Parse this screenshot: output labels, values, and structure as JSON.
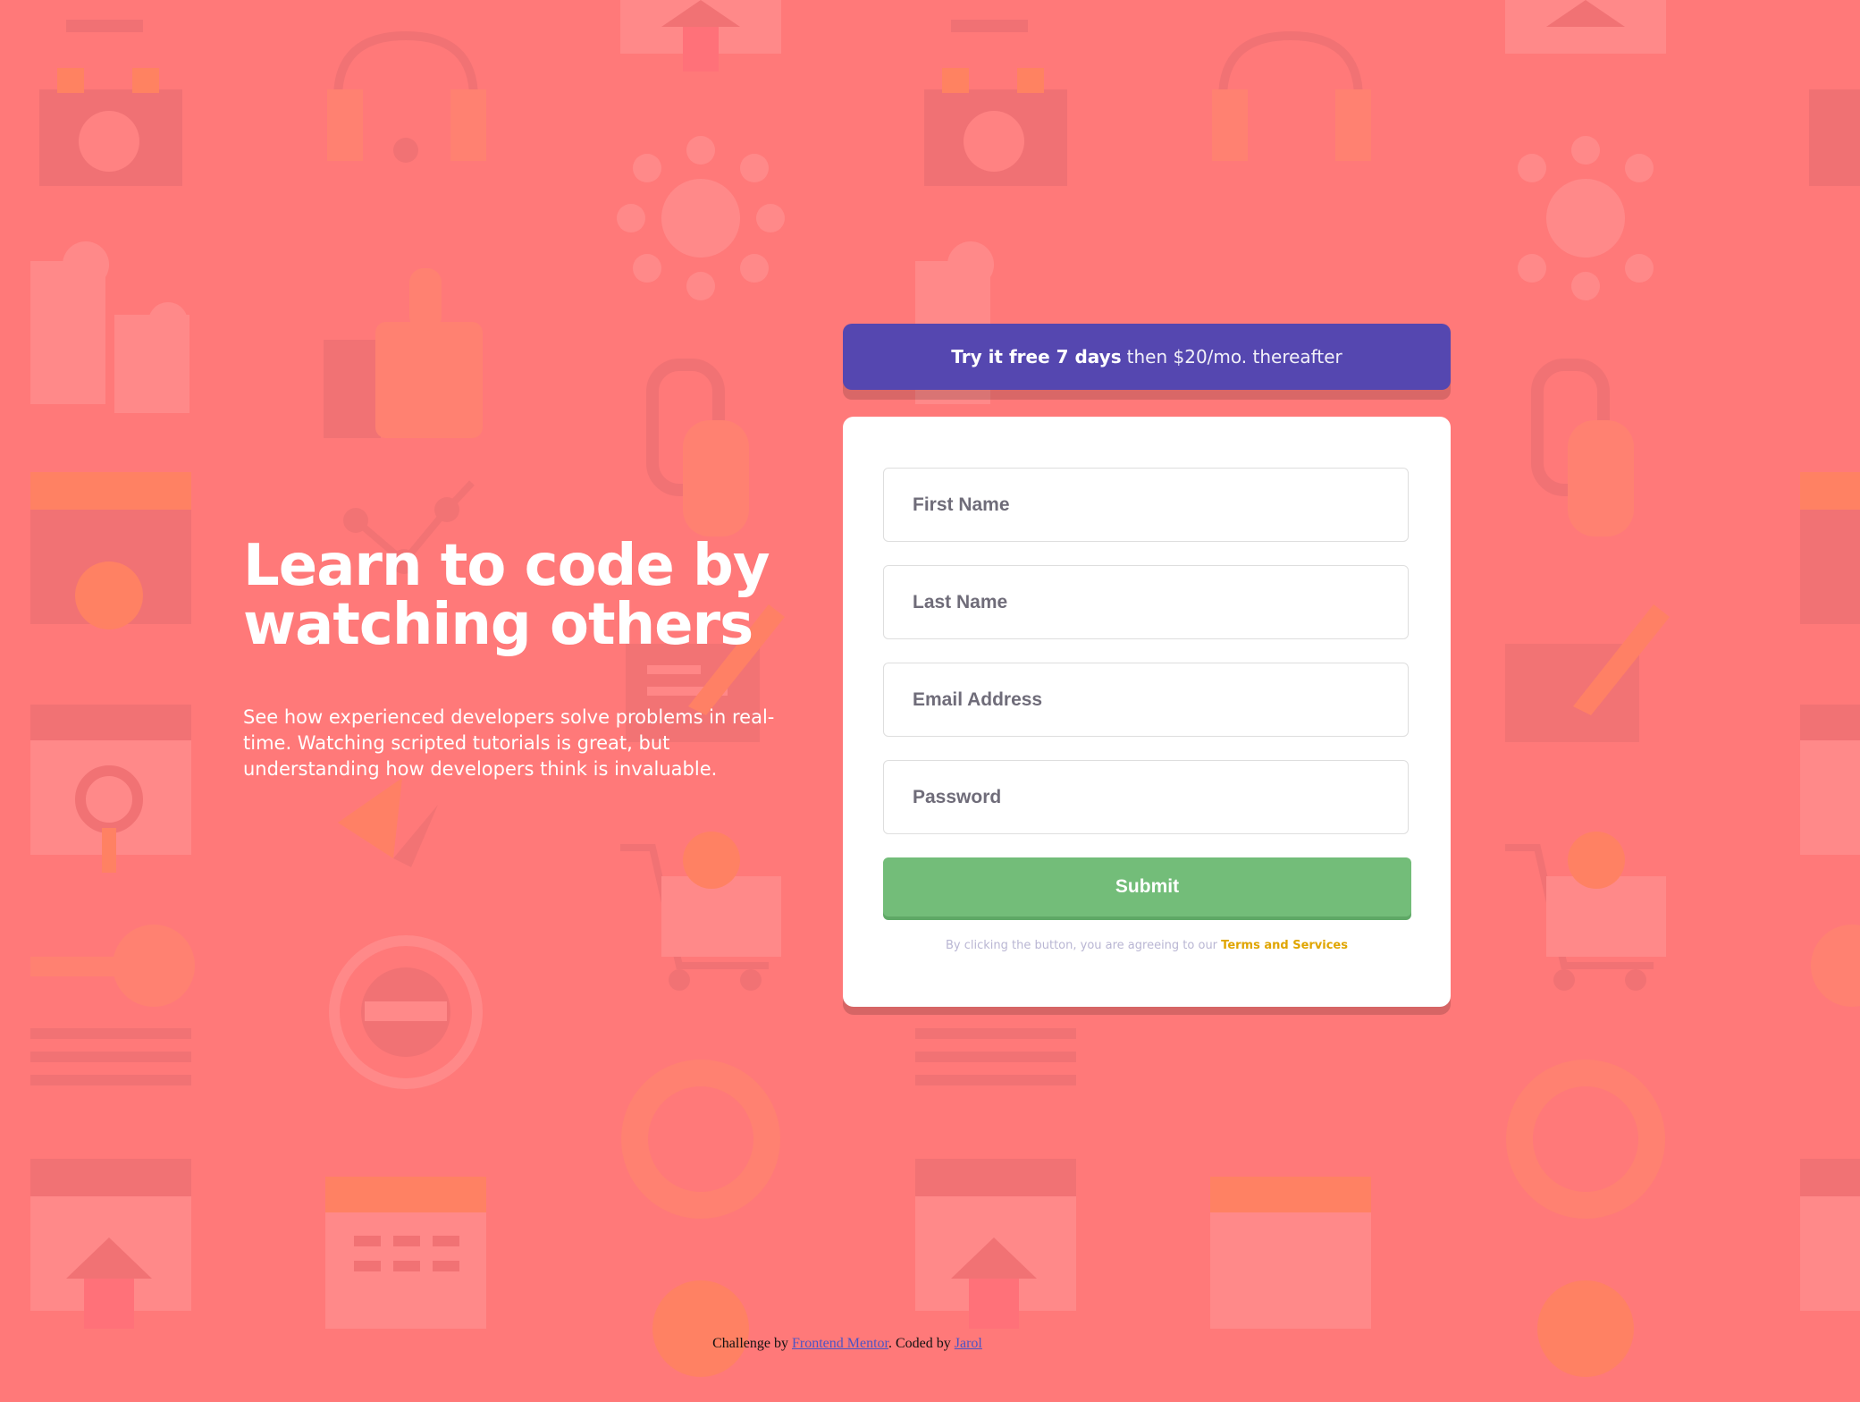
{
  "theme": {
    "background": "#ff7979",
    "promo_bg": "#5547b0",
    "submit_bg": "#73bd79",
    "terms_link": "#e0a500",
    "pattern_icons": [
      "toolbox-icon",
      "headset-icon",
      "network-icon",
      "thumbs-up-icon",
      "puzzle-icon",
      "link-icon",
      "folder-gear-icon",
      "browser-search-icon",
      "edit-icon",
      "cart-icon",
      "key-icon",
      "globe-icon",
      "lifebuoy-icon",
      "calendar-icon",
      "home-icon",
      "lightbulb-icon"
    ]
  },
  "hero": {
    "title_line1": "Learn to code by",
    "title_line2": "watching others",
    "description": "See how experienced developers solve problems in real-time. Watching scripted tutorials is great, but understanding how developers think is invaluable."
  },
  "promo": {
    "bold": "Try it free 7 days",
    "rest": "then $20/mo. thereafter"
  },
  "form": {
    "first_name_placeholder": "First Name",
    "last_name_placeholder": "Last Name",
    "email_placeholder": "Email Address",
    "password_placeholder": "Password",
    "submit_label": "Submit",
    "terms_text": "By clicking the button, you are agreeing to our",
    "terms_link": "Terms and Services"
  },
  "footer": {
    "prefix": "Challenge by",
    "mentor_link": "Frontend Mentor",
    "middle": ". Coded by",
    "author_link": "Jarol"
  }
}
